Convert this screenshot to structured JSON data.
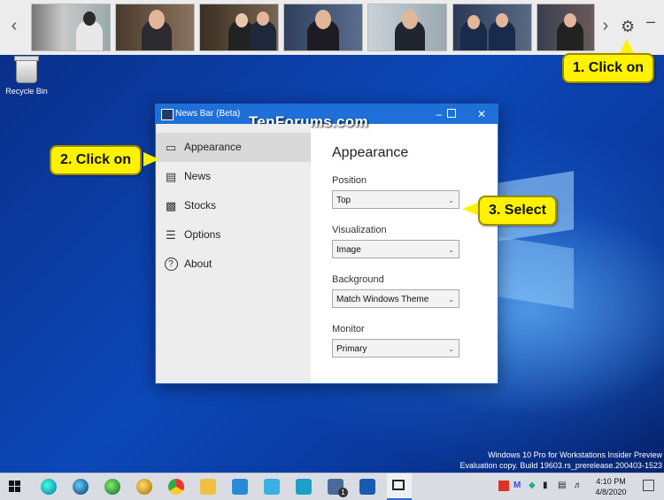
{
  "news_bar": {
    "thumbnails": [
      {
        "name": "news-thumbnail-1",
        "bg": "#8f8a80"
      },
      {
        "name": "news-thumbnail-2",
        "bg": "#6b5a4a"
      },
      {
        "name": "news-thumbnail-3",
        "bg": "#5a4a3c"
      },
      {
        "name": "news-thumbnail-4",
        "bg": "#4a5a7a"
      },
      {
        "name": "news-thumbnail-5",
        "bg": "#b8c4cc"
      },
      {
        "name": "news-thumbnail-6",
        "bg": "#3b4c6a"
      },
      {
        "name": "news-thumbnail-7",
        "bg": "#3a4050"
      }
    ]
  },
  "desktop": {
    "recycle_bin_label": "Recycle Bin",
    "eval_line1": "Windows 10 Pro for Workstations Insider Preview",
    "eval_line2": "Evaluation copy. Build 19603.rs_prerelease.200403-1523"
  },
  "callouts": {
    "step1": "1. Click on",
    "step2": "2. Click on",
    "step3": "3. Select"
  },
  "window": {
    "title": "News Bar (Beta)",
    "watermark": "TenForums.com",
    "nav": [
      {
        "label": "Appearance",
        "icon": "monitor-icon"
      },
      {
        "label": "News",
        "icon": "newspaper-icon"
      },
      {
        "label": "Stocks",
        "icon": "chart-icon"
      },
      {
        "label": "Options",
        "icon": "sliders-icon"
      },
      {
        "label": "About",
        "icon": "question-icon"
      }
    ],
    "heading": "Appearance",
    "fields": {
      "position": {
        "label": "Position",
        "value": "Top"
      },
      "visualization": {
        "label": "Visualization",
        "value": "Image"
      },
      "background": {
        "label": "Background",
        "value": "Match Windows Theme"
      },
      "monitor": {
        "label": "Monitor",
        "value": "Primary"
      }
    }
  },
  "taskbar": {
    "time": "4:10 PM",
    "date": "4/8/2020",
    "badge_count": "1"
  },
  "colors": {
    "accent": "#1f6fd8",
    "callout": "#fff200"
  }
}
